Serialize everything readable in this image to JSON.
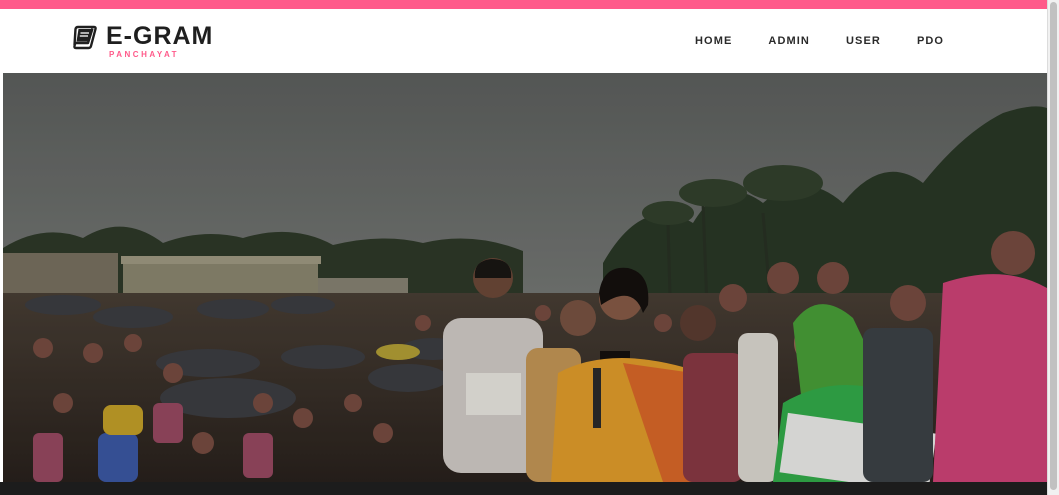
{
  "brand": {
    "title": "E-GRAM",
    "subtitle": "PANCHAYAT",
    "icon": "book-icon",
    "accent_color": "#ff5a8a"
  },
  "nav": {
    "items": [
      {
        "label": "HOME"
      },
      {
        "label": "ADMIN"
      },
      {
        "label": "USER"
      },
      {
        "label": "PDO"
      }
    ]
  },
  "hero": {
    "image_subject": "crowd-gathering-photo"
  }
}
